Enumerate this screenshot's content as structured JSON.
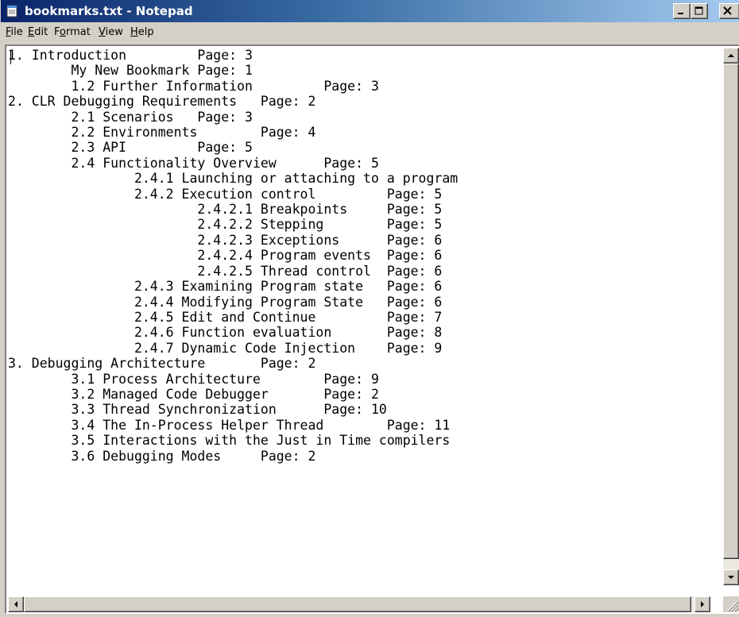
{
  "window": {
    "title": "bookmarks.txt - Notepad",
    "titlebar_colors": [
      "#0a246a",
      "#a6caf0"
    ]
  },
  "menu": [
    {
      "accel": "F",
      "rest": "ile"
    },
    {
      "accel": "E",
      "rest": "dit"
    },
    {
      "pre": "F",
      "accel": "o",
      "rest": "rmat"
    },
    {
      "accel": "V",
      "rest": "iew"
    },
    {
      "accel": "H",
      "rest": "elp"
    }
  ],
  "editor": {
    "lines": [
      "1. Introduction         Page: 3",
      "        My New Bookmark Page: 1",
      "        1.2 Further Information         Page: 3",
      "2. CLR Debugging Requirements   Page: 2",
      "        2.1 Scenarios   Page: 3",
      "        2.2 Environments        Page: 4",
      "        2.3 API         Page: 5",
      "        2.4 Functionality Overview      Page: 5",
      "                2.4.1 Launching or attaching to a program",
      "                2.4.2 Execution control         Page: 5",
      "                        2.4.2.1 Breakpoints     Page: 5",
      "                        2.4.2.2 Stepping        Page: 5",
      "                        2.4.2.3 Exceptions      Page: 6",
      "                        2.4.2.4 Program events  Page: 6",
      "                        2.4.2.5 Thread control  Page: 6",
      "                2.4.3 Examining Program state   Page: 6",
      "                2.4.4 Modifying Program State   Page: 6",
      "                2.4.5 Edit and Continue         Page: 7",
      "                2.4.6 Function evaluation       Page: 8",
      "                2.4.7 Dynamic Code Injection    Page: 9",
      "3. Debugging Architecture       Page: 2",
      "        3.1 Process Architecture        Page: 9",
      "        3.2 Managed Code Debugger       Page: 2",
      "        3.3 Thread Synchronization      Page: 10",
      "        3.4 The In-Process Helper Thread        Page: 11",
      "        3.5 Interactions with the Just in Time compilers",
      "        3.6 Debugging Modes     Page: 2"
    ]
  }
}
